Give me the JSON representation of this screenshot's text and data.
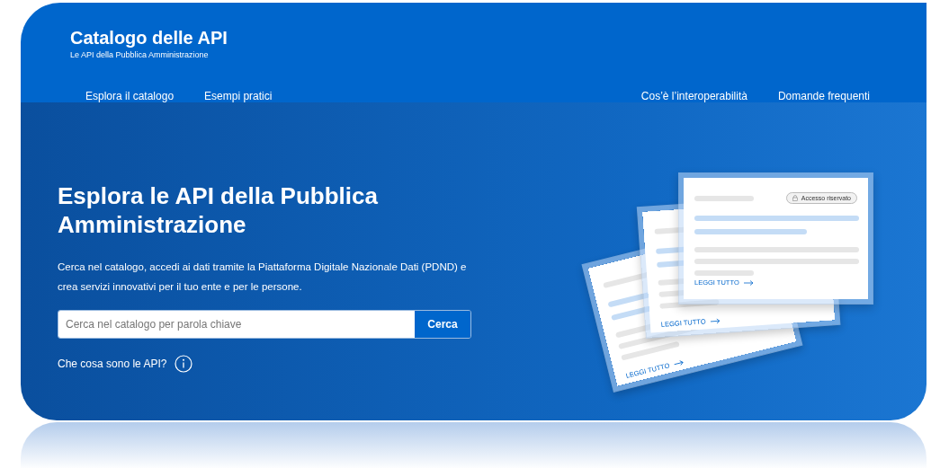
{
  "header": {
    "title": "Catalogo delle API",
    "subtitle": "Le API della Pubblica Amministrazione",
    "nav_left": [
      "Esplora il catalogo",
      "Esempi pratici"
    ],
    "nav_right": [
      "Cos’è l’interoperabilità",
      "Domande frequenti"
    ]
  },
  "hero": {
    "title": "Esplora le API della Pubblica Amministrazione",
    "description": "Cerca nel catalogo, accedi ai dati tramite la Piattaforma Digitale Nazionale Dati (PDND) e crea servizi innovativi per il tuo ente e per le persone.",
    "search": {
      "placeholder": "Cerca nel catalogo per parola chiave",
      "button": "Cerca"
    },
    "help_link": "Che cosa sono le API?"
  },
  "illustration": {
    "badge": "Accesso riservato",
    "cards": [
      {
        "link": "LEGGI TUTTO"
      },
      {
        "link": "LEGGI TUTTO"
      },
      {
        "link": "LEGGI TUTTO"
      }
    ]
  }
}
